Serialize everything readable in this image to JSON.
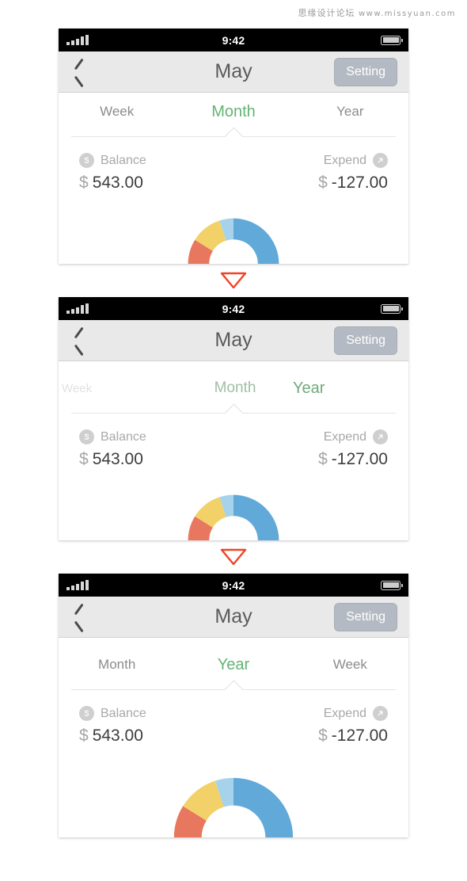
{
  "watermark": {
    "cn": "思缘设计论坛",
    "url": "www.missyuan.com"
  },
  "statusbar": {
    "time": "9:42",
    "signal_icon": "signal-bars-icon",
    "battery_icon": "battery-icon"
  },
  "navbar": {
    "back_icon": "back-chevron-icon",
    "title": "May",
    "setting_label": "Setting"
  },
  "summary": {
    "balance_label": "Balance",
    "balance_icon": "dollar-circle-icon",
    "balance_currency": "$",
    "balance_value": "543.00",
    "expend_label": "Expend",
    "expend_icon": "arrow-up-right-circle-icon",
    "expend_currency": "$",
    "expend_value": "-127.00"
  },
  "screens": [
    {
      "id": "screen-month",
      "tabs": [
        {
          "label": "Week",
          "state": "inactive"
        },
        {
          "label": "Month",
          "state": "active"
        },
        {
          "label": "Year",
          "state": "inactive"
        }
      ]
    },
    {
      "id": "screen-transition",
      "tabs": [
        {
          "label": "Week",
          "state": "faded"
        },
        {
          "label": "Month",
          "state": "semi"
        },
        {
          "label": "Year",
          "state": "semi2"
        }
      ]
    },
    {
      "id": "screen-year",
      "tabs": [
        {
          "label": "Month",
          "state": "inactive"
        },
        {
          "label": "Year",
          "state": "active"
        },
        {
          "label": "Week",
          "state": "inactive"
        }
      ]
    }
  ],
  "separator": {
    "icon": "triangle-down-icon",
    "color": "#f04425"
  },
  "colors": {
    "accent_green": "#63b473",
    "blue": "#61a9d8",
    "light_blue": "#a6d3eb",
    "yellow": "#f2d268",
    "red": "#e8775f",
    "navbar_bg": "#e9e9e9",
    "setting_bg": "#b4bac3"
  },
  "chart_data": {
    "type": "pie",
    "title": "",
    "variant": "half-donut",
    "start_angle": 180,
    "end_angle": 360,
    "legend": "none",
    "labels": [
      "Blue",
      "Light Blue",
      "Yellow",
      "Red"
    ],
    "values": [
      90,
      18,
      40,
      32
    ],
    "unit": "degrees",
    "colors": [
      "#61a9d8",
      "#a6d3eb",
      "#f2d268",
      "#e8775f"
    ]
  }
}
